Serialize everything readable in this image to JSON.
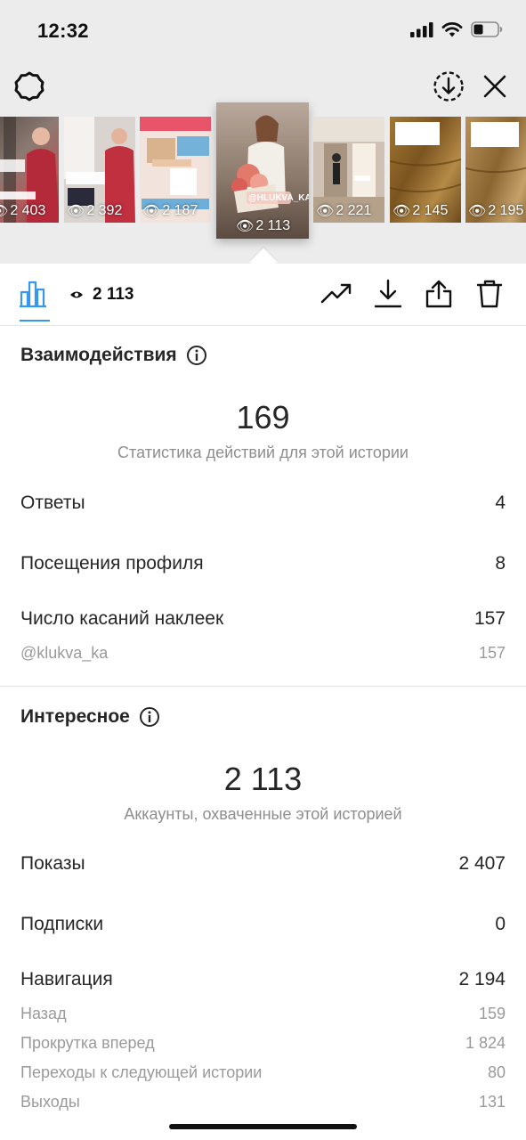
{
  "status_bar": {
    "time": "12:32",
    "icons": [
      "signal-icon",
      "wifi-icon",
      "battery-icon"
    ]
  },
  "top_bar": {
    "left_icon": "settings-ring-icon",
    "right_icons": [
      "download-circle-icon",
      "close-icon"
    ]
  },
  "stories": [
    {
      "views": "2 403",
      "active": false
    },
    {
      "views": "2 392",
      "active": false
    },
    {
      "views": "2 187",
      "active": false
    },
    {
      "views": "2 113",
      "active": true,
      "sticker": "@HLUKVA_KA"
    },
    {
      "views": "2 221",
      "active": false
    },
    {
      "views": "2 145",
      "active": false
    },
    {
      "views": "2 195",
      "active": false
    }
  ],
  "toolbar": {
    "views_count": "2 113",
    "icons": [
      "insights-bar-icon",
      "eye-icon",
      "trending-icon",
      "download-icon",
      "share-icon",
      "trash-icon"
    ],
    "accent_color": "#3797f0"
  },
  "interactions": {
    "title": "Взаимодействия",
    "total": "169",
    "caption": "Статистика действий для этой истории",
    "rows": [
      {
        "label": "Ответы",
        "value": "4"
      },
      {
        "label": "Посещения профиля",
        "value": "8"
      },
      {
        "label": "Число касаний наклеек",
        "value": "157"
      }
    ],
    "sticker_row": {
      "label": "@klukva_ka",
      "value": "157"
    }
  },
  "discovery": {
    "title": "Интересное",
    "total": "2 113",
    "caption": "Аккаунты, охваченные этой историей",
    "rows": [
      {
        "label": "Показы",
        "value": "2 407"
      },
      {
        "label": "Подписки",
        "value": "0"
      },
      {
        "label": "Навигация",
        "value": "2 194"
      }
    ],
    "navigation_details": [
      {
        "label": "Назад",
        "value": "159"
      },
      {
        "label": "Прокрутка вперед",
        "value": "1 824"
      },
      {
        "label": "Переходы к следующей истории",
        "value": "80"
      },
      {
        "label": "Выходы",
        "value": "131"
      }
    ]
  }
}
